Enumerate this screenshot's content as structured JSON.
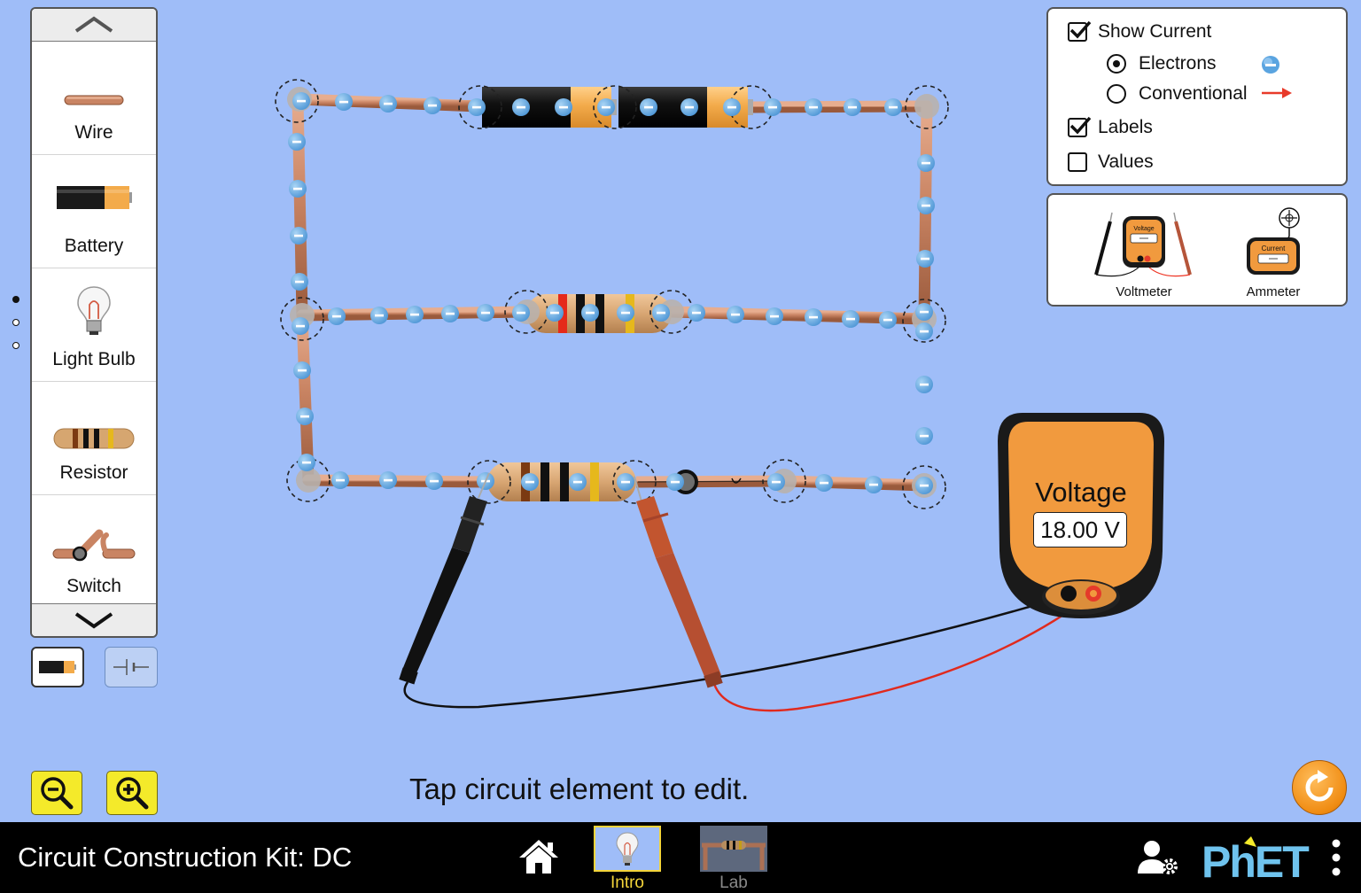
{
  "toolbox": {
    "items": [
      {
        "label": "Wire"
      },
      {
        "label": "Battery"
      },
      {
        "label": "Light Bulb"
      },
      {
        "label": "Resistor"
      },
      {
        "label": "Switch"
      }
    ],
    "scroll_up_icon": "chevron-up-icon",
    "scroll_down_icon": "chevron-down-icon",
    "view_modes": [
      "lifelike",
      "schematic"
    ],
    "selected_view": "lifelike"
  },
  "options": {
    "show_current": {
      "label": "Show Current",
      "checked": true
    },
    "electrons": {
      "label": "Electrons",
      "selected": true
    },
    "conventional": {
      "label": "Conventional",
      "selected": false
    },
    "labels": {
      "label": "Labels",
      "checked": true
    },
    "values": {
      "label": "Values",
      "checked": false
    }
  },
  "meters": {
    "voltmeter": {
      "label": "Voltmeter",
      "icon_text": "Voltage"
    },
    "ammeter": {
      "label": "Ammeter",
      "icon_text": "Current"
    }
  },
  "voltmeter": {
    "title": "Voltage",
    "reading": "18.00 V"
  },
  "hint": "Tap circuit element to edit.",
  "navbar": {
    "title": "Circuit Construction Kit: DC",
    "screens": [
      {
        "label": "Intro",
        "selected": true
      },
      {
        "label": "Lab",
        "selected": false
      }
    ],
    "logo_text": "PhET"
  },
  "colors": {
    "background": "#9fbdf8",
    "wire": "#c98463",
    "electron": "#5aa4e0",
    "accent_yellow": "#f4ea2a",
    "selected_tab": "#f4d53a",
    "meter_orange": "#f19a3e"
  }
}
